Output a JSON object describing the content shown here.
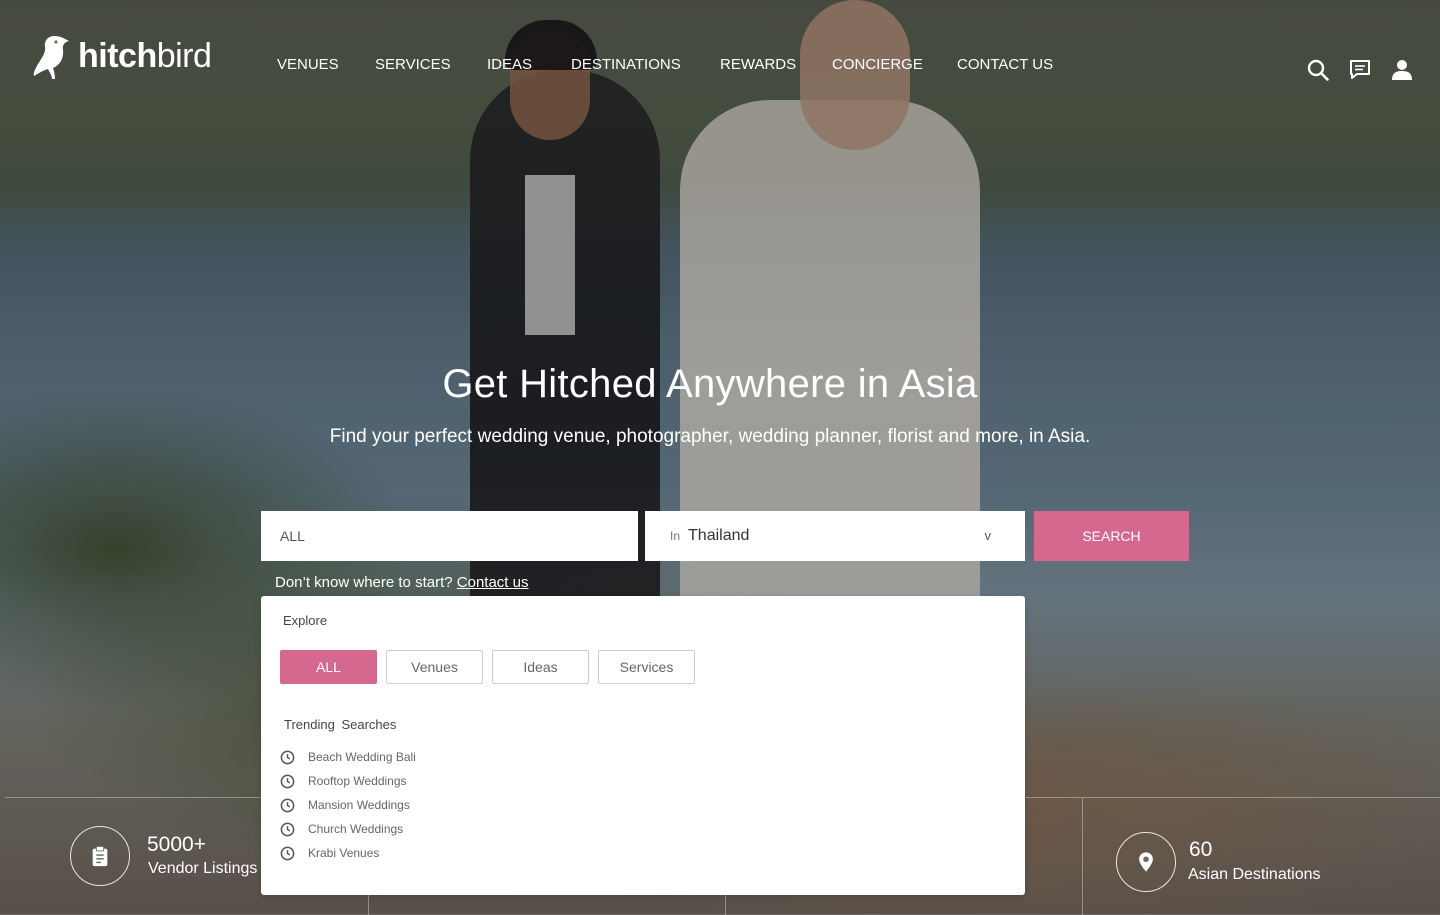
{
  "brand": {
    "name_bold": "hitch",
    "name_light": "bird"
  },
  "nav": {
    "items": [
      "VENUES",
      "SERVICES",
      "IDEAS",
      "DESTINATIONS",
      "REWARDS",
      "CONCIERGE",
      "CONTACT US"
    ]
  },
  "header_icons": [
    "search-icon",
    "chat-icon",
    "user-icon"
  ],
  "hero": {
    "title": "Get Hitched Anywhere in Asia",
    "subtitle": "Find your perfect wedding venue, photographer, wedding planner, florist and more, in Asia."
  },
  "search": {
    "what_value": "ALL",
    "where_prefix": "In",
    "where_value": "Thailand",
    "where_caret": "v",
    "button_label": "SEARCH"
  },
  "hint": {
    "text": "Don’t know where to start?",
    "link": "Contact us"
  },
  "explore": {
    "label": "Explore",
    "chips": [
      "ALL",
      "Venues",
      "Ideas",
      "Services"
    ],
    "active_chip": "ALL",
    "trending_label": "Trending Searches",
    "trending": [
      "Beach Wedding Bali",
      "Rooftop Weddings",
      "Mansion Weddings",
      "Church Weddings",
      "Krabi Venues"
    ]
  },
  "stats": [
    {
      "icon": "clipboard-icon",
      "number": "5000+",
      "label": "Vendor Listings"
    },
    {
      "icon": "map-pin-icon",
      "number": "60",
      "label": "Asian Destinations"
    }
  ],
  "colors": {
    "accent": "#d4688e",
    "text_light": "#ffffff"
  }
}
